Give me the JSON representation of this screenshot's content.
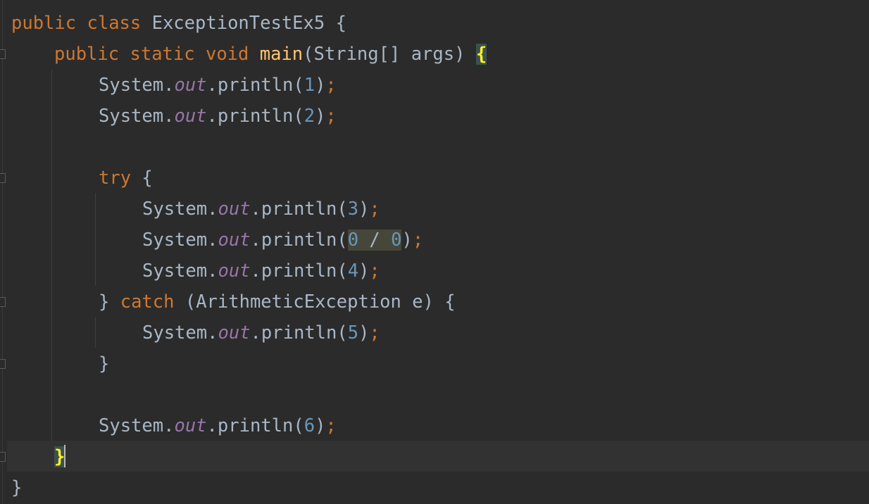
{
  "editor": {
    "theme": {
      "background": "#2b2b2b",
      "keyword": "#cc7832",
      "function": "#ffc66d",
      "field": "#9876aa",
      "number": "#6897bb",
      "text": "#a9b7c6",
      "brace_match": "#ffef28"
    },
    "lines": [
      {
        "public": "public",
        "class": "class",
        "name": " ExceptionTestEx5 ",
        "open": "{"
      },
      {
        "public": "public",
        "static": "static",
        "void": "void",
        "main": "main",
        "params": "(String[] args) ",
        "open": "{"
      },
      {
        "system": "System.",
        "out": "out",
        "call": ".println(",
        "arg": "1",
        "close": ")",
        "semi": ";"
      },
      {
        "system": "System.",
        "out": "out",
        "call": ".println(",
        "arg": "2",
        "close": ")",
        "semi": ";"
      },
      {
        "try": "try",
        "open": " {"
      },
      {
        "system": "System.",
        "out": "out",
        "call": ".println(",
        "arg": "3",
        "close": ")",
        "semi": ";"
      },
      {
        "system": "System.",
        "out": "out",
        "call": ".println(",
        "arg_a": "0",
        "op": " / ",
        "arg_b": "0",
        "close": ")",
        "semi": ";"
      },
      {
        "system": "System.",
        "out": "out",
        "call": ".println(",
        "arg": "4",
        "close": ")",
        "semi": ";"
      },
      {
        "close_brace": "} ",
        "catch": "catch",
        "params": " (ArithmeticException e) {"
      },
      {
        "system": "System.",
        "out": "out",
        "call": ".println(",
        "arg": "5",
        "close": ")",
        "semi": ";"
      },
      {
        "close_brace": "}"
      },
      {
        "system": "System.",
        "out": "out",
        "call": ".println(",
        "arg": "6",
        "close": ")",
        "semi": ";"
      },
      {
        "close_brace": "}"
      },
      {
        "close_brace": "}"
      }
    ]
  }
}
